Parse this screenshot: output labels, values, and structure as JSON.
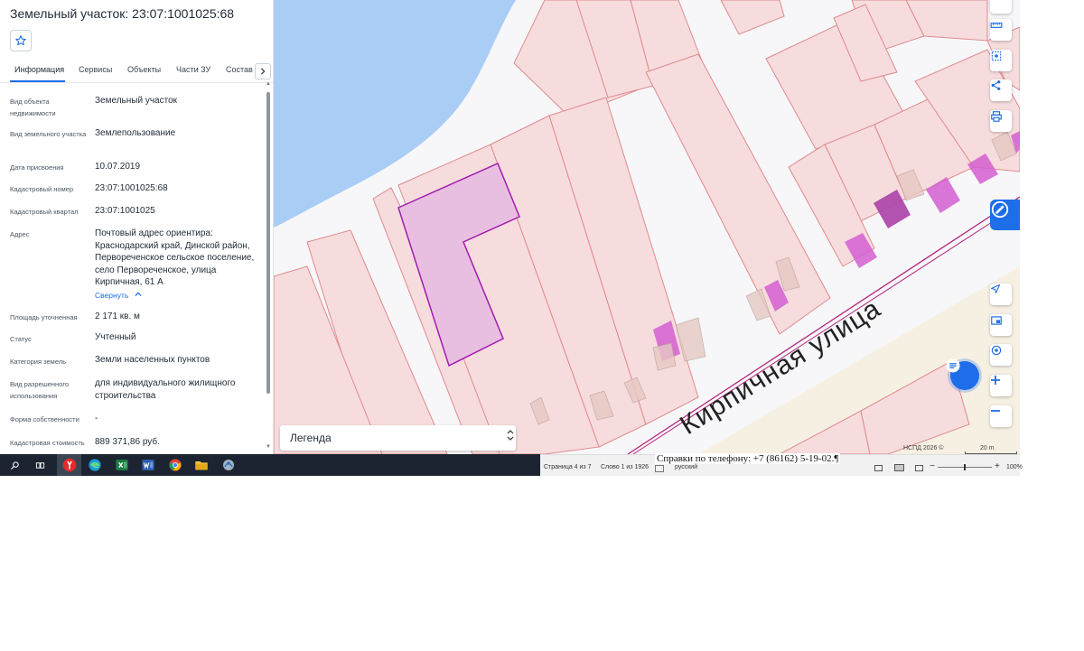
{
  "panel": {
    "title": "Земельный участок: 23:07:1001025:68",
    "tabs": [
      {
        "label": "Информация",
        "active": true
      },
      {
        "label": "Сервисы"
      },
      {
        "label": "Объекты"
      },
      {
        "label": "Части ЗУ"
      },
      {
        "label": "Состав"
      }
    ],
    "next_tab_icon": "chevron-right-icon",
    "favorite_icon": "star-icon",
    "properties": [
      {
        "label": "Вид объекта недвижимости",
        "value": "Земельный участок"
      },
      {
        "label": "Вид земельного участка",
        "value": "Землепользование"
      },
      {
        "label": "Дата присвоения",
        "value": "10.07.2019"
      },
      {
        "label": "Кадастровый номер",
        "value": "23:07:1001025:68"
      },
      {
        "label": "Кадастровый квартал",
        "value": "23:07:1001025"
      },
      {
        "label": "Адрес",
        "value": "Почтовый адрес ориентира: Краснодарский край, Динской район, Первореченское сельское поселение, село Первореченское, улица Кирпичная, 61 А"
      },
      {
        "label": "Площадь уточненная",
        "value": "2 171 кв. м"
      },
      {
        "label": "Статус",
        "value": "Учтенный"
      },
      {
        "label": "Категория земель",
        "value": "Земли населенных пунктов"
      },
      {
        "label": "Вид разрешенного использования",
        "value": "для индивидуального жилищного строительства"
      },
      {
        "label": "Форма собственности",
        "value": "-"
      },
      {
        "label": "Кадастровая стоимость",
        "value": "889 371,86 руб."
      }
    ],
    "collapse_link": "Свернуть"
  },
  "map": {
    "street_label": "Кирпичная  улица",
    "legend_label": "Легенда",
    "copyright": "НСПД 2026 ©",
    "scale": "20 m",
    "colors": {
      "water": "#a9cdf5",
      "parcel_fill": "#f6dcdd",
      "parcel_stroke": "#e08a8f",
      "selected_fill": "#e8bfe0",
      "selected_stroke": "#a21caf",
      "building": "#d45fd0",
      "accent": "#1d6ee8"
    },
    "toolbar_icons": [
      "layers-icon",
      "ruler-icon",
      "select-area-icon",
      "share-icon",
      "print-icon",
      "locate-icon",
      "minimap-icon",
      "geolocation-icon",
      "zoom-in-icon",
      "zoom-out-icon"
    ]
  },
  "taskbar": {
    "icons": [
      "search-icon",
      "task-view-icon",
      "yandex-browser-icon",
      "edge-icon",
      "excel-icon",
      "word-icon",
      "chrome-icon",
      "file-explorer-icon",
      "network-icon"
    ]
  },
  "word_status": {
    "doc_line": "Справки по телефону: +7 (86162) 5-19-02.¶",
    "page": "Страница 4 из 7",
    "words": "Слово 1 из 1926",
    "language": "русский",
    "zoom": "100%"
  }
}
